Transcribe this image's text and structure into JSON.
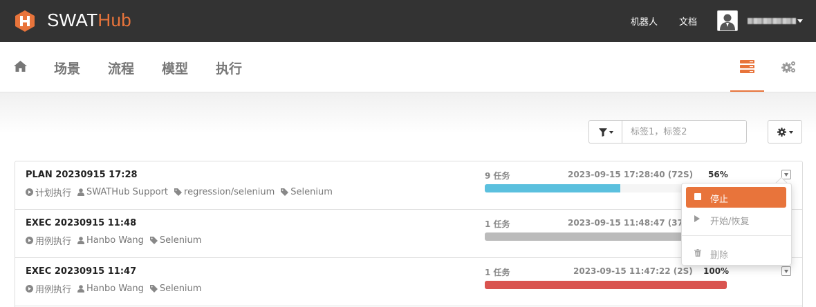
{
  "brand": {
    "name_main": "SWAT",
    "name_accent": "Hub",
    "accent_color": "#e8743b"
  },
  "topnav": {
    "robots": "机器人",
    "docs": "文档"
  },
  "subnav": {
    "items": [
      "场景",
      "流程",
      "模型",
      "执行"
    ],
    "active_icon": "list-icon",
    "settings_icon": "cogs-icon"
  },
  "toolbar": {
    "filter_placeholder": "标签1，标签2",
    "filter_value": ""
  },
  "executions": [
    {
      "title": "PLAN 20230915 17:28",
      "type": "计划执行",
      "owner": "SWATHub Support",
      "tags": [
        "regression/selenium",
        "Selenium"
      ],
      "tasks": "9 任务",
      "time": "2023-09-15 17:28:40 (72S)",
      "percent": "56%",
      "progress": 0.56,
      "bar_color": "#5bc0de"
    },
    {
      "title": "EXEC 20230915 11:48",
      "type": "用例执行",
      "owner": "Hanbo Wang",
      "tags": [
        "Selenium"
      ],
      "tasks": "1 任务",
      "time": "2023-09-15 11:48:47 (37S)",
      "percent": "",
      "progress": 1.0,
      "bar_color": "#bbbbbb"
    },
    {
      "title": "EXEC 20230915 11:47",
      "type": "用例执行",
      "owner": "Hanbo Wang",
      "tags": [
        "Selenium"
      ],
      "tasks": "1 任务",
      "time": "2023-09-15 11:47:22 (2S)",
      "percent": "100%",
      "progress": 1.0,
      "bar_color": "#d9534f"
    }
  ],
  "row_menu": {
    "stop": "停止",
    "start_resume": "开始/恢复",
    "delete": "删除"
  }
}
